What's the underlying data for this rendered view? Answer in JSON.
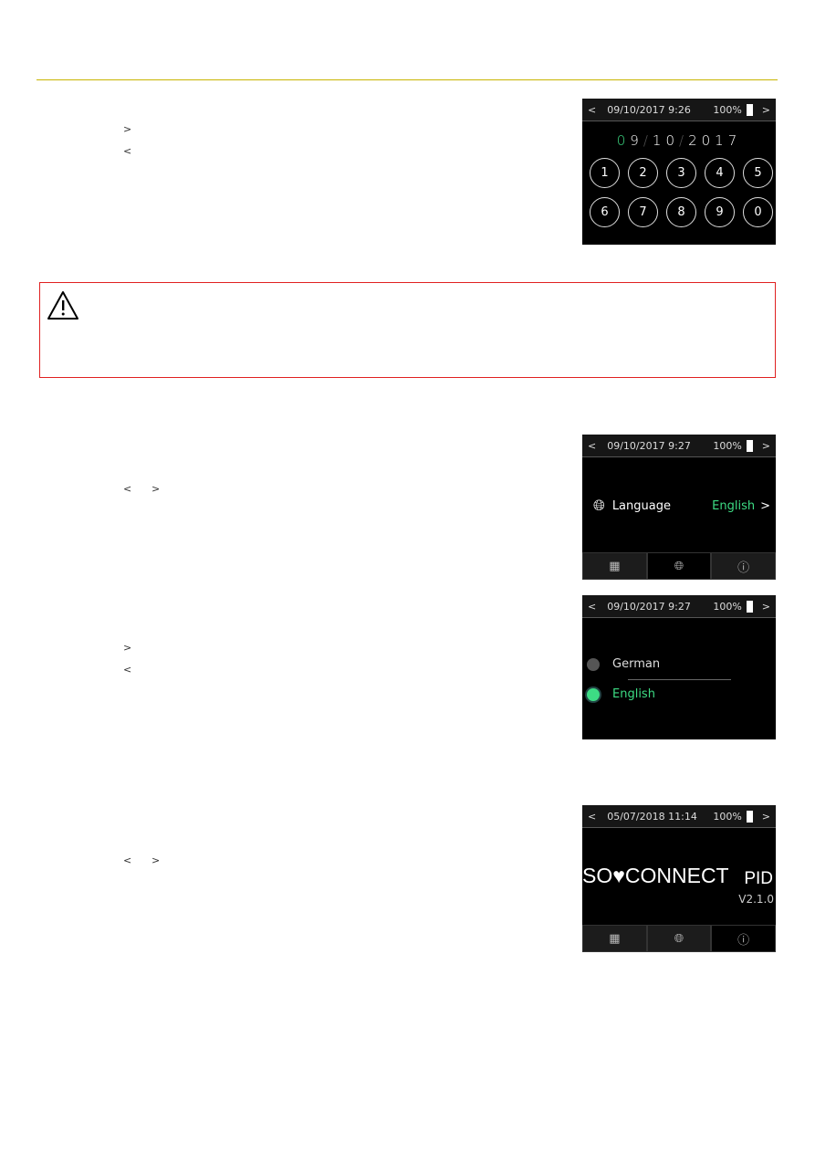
{
  "accent": "#3ddc84",
  "warning_border": "#e02020",
  "nav_glyphs": {
    "next": ">",
    "prev": "<"
  },
  "screen_date": {
    "datetime": "09/10/2017 9:26",
    "battery": "100%",
    "date_parts": [
      "0",
      "9",
      "/",
      "1",
      "0",
      "/",
      "2",
      "0",
      "1",
      "7"
    ],
    "keys": [
      "1",
      "2",
      "3",
      "4",
      "5",
      "6",
      "7",
      "8",
      "9",
      "0"
    ]
  },
  "screen_language": {
    "datetime": "09/10/2017 9:27",
    "battery": "100%",
    "label": "Language",
    "value": "English",
    "tabs": [
      "calendar-icon",
      "globe-icon",
      "info-icon"
    ]
  },
  "screen_select": {
    "datetime": "09/10/2017 9:27",
    "battery": "100%",
    "options": [
      {
        "label": "German",
        "selected": false
      },
      {
        "label": "English",
        "selected": true
      }
    ]
  },
  "screen_info": {
    "datetime": "05/07/2018 11:14",
    "battery": "100%",
    "brand": "SO♥CONNECT",
    "product": "PID",
    "version": "V2.1.0"
  }
}
